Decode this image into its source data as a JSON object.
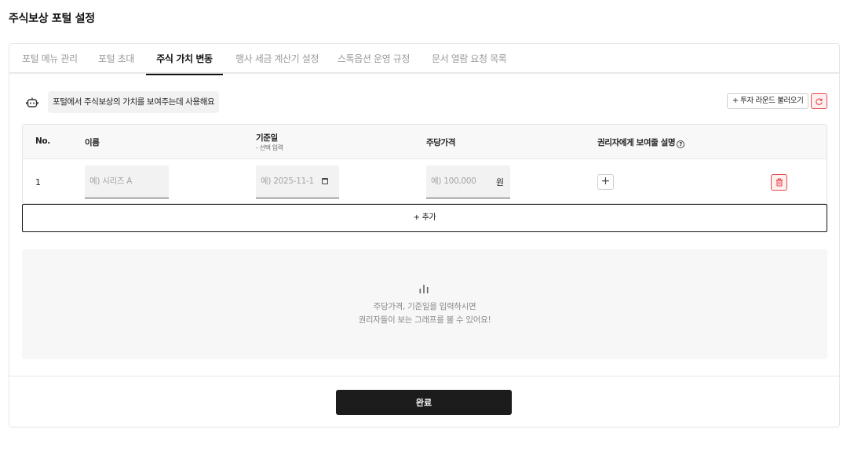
{
  "page": {
    "title": "주식보상 포털 설정"
  },
  "tabs": [
    {
      "label": "포털 메뉴 관리",
      "active": false
    },
    {
      "label": "포털 초대",
      "active": false
    },
    {
      "label": "주식 가치 변동",
      "active": true
    },
    {
      "label": "행사 세금 계산기 설정",
      "active": false
    },
    {
      "label": "스톡옵션 운영 규정",
      "active": false
    },
    {
      "label": "문서 열람 요청 목록",
      "active": false
    }
  ],
  "info": {
    "icon": "robot-icon",
    "text": "포털에서 주식보상의 가치를 보여주는데 사용해요"
  },
  "toolbar": {
    "load_rounds_label": "+ 투자 라운드 불러오기",
    "reset_icon": "refresh-icon"
  },
  "table": {
    "headers": {
      "no": "No.",
      "name": "이름",
      "date": "기준일",
      "date_sub": "- 선택 입력",
      "price": "주당가격",
      "description": "권리자에게 보여줄 설명",
      "description_help": "?"
    },
    "rows": [
      {
        "no": "1",
        "name_placeholder": "예) 시리즈 A",
        "date_placeholder": "예) 2025-11-1",
        "price_placeholder": "예) 100,000",
        "price_unit": "원",
        "add_description_label": "+"
      }
    ]
  },
  "add_row": {
    "label": "+ 추가"
  },
  "chart_empty": {
    "icon": "bar-chart-icon",
    "line1": "주당가격, 기준일을 입력하시면",
    "line2": "권리자들이 보는 그래프를 볼 수 있어요!"
  },
  "footer": {
    "done_label": "완료"
  },
  "colors": {
    "accent_dark": "#1c1c1c",
    "danger": "#e5484d"
  }
}
